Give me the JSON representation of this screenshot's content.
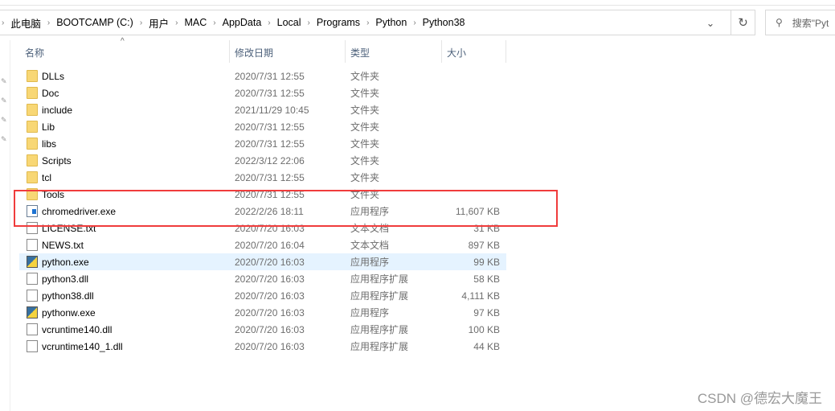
{
  "breadcrumb": [
    "此电脑",
    "BOOTCAMP (C:)",
    "用户",
    "MAC",
    "AppData",
    "Local",
    "Programs",
    "Python",
    "Python38"
  ],
  "search": {
    "placeholder": "搜索\"Pyt"
  },
  "columns": {
    "name": "名称",
    "date": "修改日期",
    "type": "类型",
    "size": "大小"
  },
  "files": [
    {
      "name": "DLLs",
      "date": "2020/7/31 12:55",
      "type": "文件夹",
      "size": "",
      "icon": "folder"
    },
    {
      "name": "Doc",
      "date": "2020/7/31 12:55",
      "type": "文件夹",
      "size": "",
      "icon": "folder"
    },
    {
      "name": "include",
      "date": "2021/11/29 10:45",
      "type": "文件夹",
      "size": "",
      "icon": "folder"
    },
    {
      "name": "Lib",
      "date": "2020/7/31 12:55",
      "type": "文件夹",
      "size": "",
      "icon": "folder"
    },
    {
      "name": "libs",
      "date": "2020/7/31 12:55",
      "type": "文件夹",
      "size": "",
      "icon": "folder"
    },
    {
      "name": "Scripts",
      "date": "2022/3/12 22:06",
      "type": "文件夹",
      "size": "",
      "icon": "folder"
    },
    {
      "name": "tcl",
      "date": "2020/7/31 12:55",
      "type": "文件夹",
      "size": "",
      "icon": "folder"
    },
    {
      "name": "Tools",
      "date": "2020/7/31 12:55",
      "type": "文件夹",
      "size": "",
      "icon": "folder"
    },
    {
      "name": "chromedriver.exe",
      "date": "2022/2/26 18:11",
      "type": "应用程序",
      "size": "11,607 KB",
      "icon": "exe"
    },
    {
      "name": "LICENSE.txt",
      "date": "2020/7/20 16:03",
      "type": "文本文档",
      "size": "31 KB",
      "icon": "file"
    },
    {
      "name": "NEWS.txt",
      "date": "2020/7/20 16:04",
      "type": "文本文档",
      "size": "897 KB",
      "icon": "file"
    },
    {
      "name": "python.exe",
      "date": "2020/7/20 16:03",
      "type": "应用程序",
      "size": "99 KB",
      "icon": "py",
      "selected": true
    },
    {
      "name": "python3.dll",
      "date": "2020/7/20 16:03",
      "type": "应用程序扩展",
      "size": "58 KB",
      "icon": "file"
    },
    {
      "name": "python38.dll",
      "date": "2020/7/20 16:03",
      "type": "应用程序扩展",
      "size": "4,111 KB",
      "icon": "file"
    },
    {
      "name": "pythonw.exe",
      "date": "2020/7/20 16:03",
      "type": "应用程序",
      "size": "97 KB",
      "icon": "py"
    },
    {
      "name": "vcruntime140.dll",
      "date": "2020/7/20 16:03",
      "type": "应用程序扩展",
      "size": "100 KB",
      "icon": "file"
    },
    {
      "name": "vcruntime140_1.dll",
      "date": "2020/7/20 16:03",
      "type": "应用程序扩展",
      "size": "44 KB",
      "icon": "file"
    }
  ],
  "highlight_color": "#f03c3c",
  "watermark": "CSDN @德宏大魔王"
}
